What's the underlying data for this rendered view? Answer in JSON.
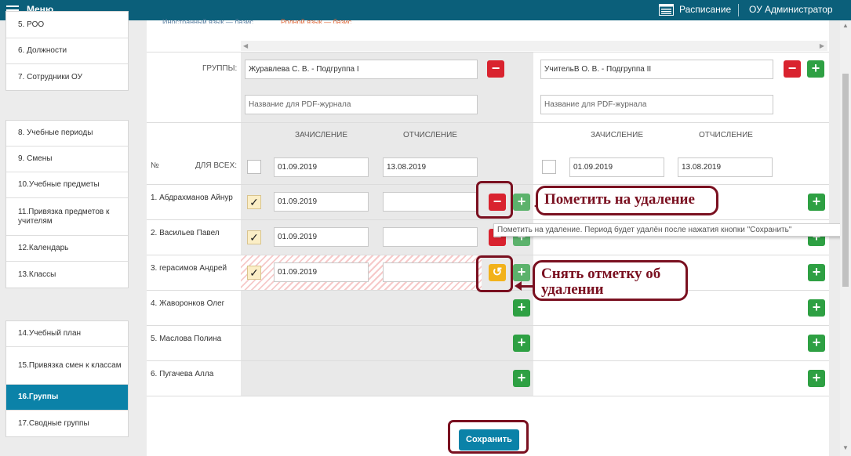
{
  "topbar": {
    "menu_label": "Меню",
    "schedule_label": "Расписание",
    "user_label": "ОУ Администратор"
  },
  "sidebar": {
    "group1": [
      "5. РОО",
      "6. Должности",
      "7. Сотрудники ОУ"
    ],
    "group2": [
      "8. Учебные периоды",
      "9. Смены",
      "10.Учебные предметы",
      "11.Привязка предметов к учителям",
      "12.Календарь",
      "13.Классы"
    ],
    "group3": [
      "14.Учебный план",
      "15.Привязка смен к классам",
      "16.Группы",
      "17.Сводные группы"
    ],
    "active": "16.Группы"
  },
  "header_partial": {
    "left": "Иностранный язык — базис.",
    "right": "Родной язык — базис."
  },
  "groups": {
    "label": "ГРУППЫ:",
    "group1_name": "Журавлева С. В. - Подгруппа I",
    "group2_name": "УчительВ О. В. - Подгруппа II",
    "pdf_placeholder": "Название для PDF-журнала"
  },
  "columns": {
    "enroll": "ЗАЧИСЛЕНИЕ",
    "expel": "ОТЧИСЛЕНИЕ",
    "num": "№",
    "for_all": "ДЛЯ ВСЕХ:"
  },
  "for_all_dates": {
    "enroll": "01.09.2019",
    "expel": "13.08.2019"
  },
  "students": [
    {
      "name": "1. Абдрахманов Айнур",
      "enroll": "01.09.2019"
    },
    {
      "name": "2. Васильев Павел",
      "enroll": "01.09.2019"
    },
    {
      "name": "3. герасимов Андрей",
      "enroll": "01.09.2019"
    },
    {
      "name": "4. Жаворонков Олег"
    },
    {
      "name": "5. Маслова Полина"
    },
    {
      "name": "6. Пугачева Алла"
    }
  ],
  "tooltip": "Пометить на удаление. Период будет удалён после нажатия кнопки \"Сохранить\"",
  "callouts": {
    "mark": "Пометить на удаление",
    "unmark": "Снять отметку об удалении"
  },
  "save_label": "Сохранить",
  "icons": {
    "menu": "hamburger-icon",
    "schedule": "calendar-icon",
    "remove": "minus-icon",
    "add": "plus-icon",
    "undo": "undo-icon",
    "check": "checkmark-icon"
  },
  "colors": {
    "topbar": "#0b5f7a",
    "active": "#0b82a8",
    "red": "#d9232f",
    "green": "#2ea043",
    "yellow": "#f2b21b",
    "callout": "#7a1020"
  }
}
